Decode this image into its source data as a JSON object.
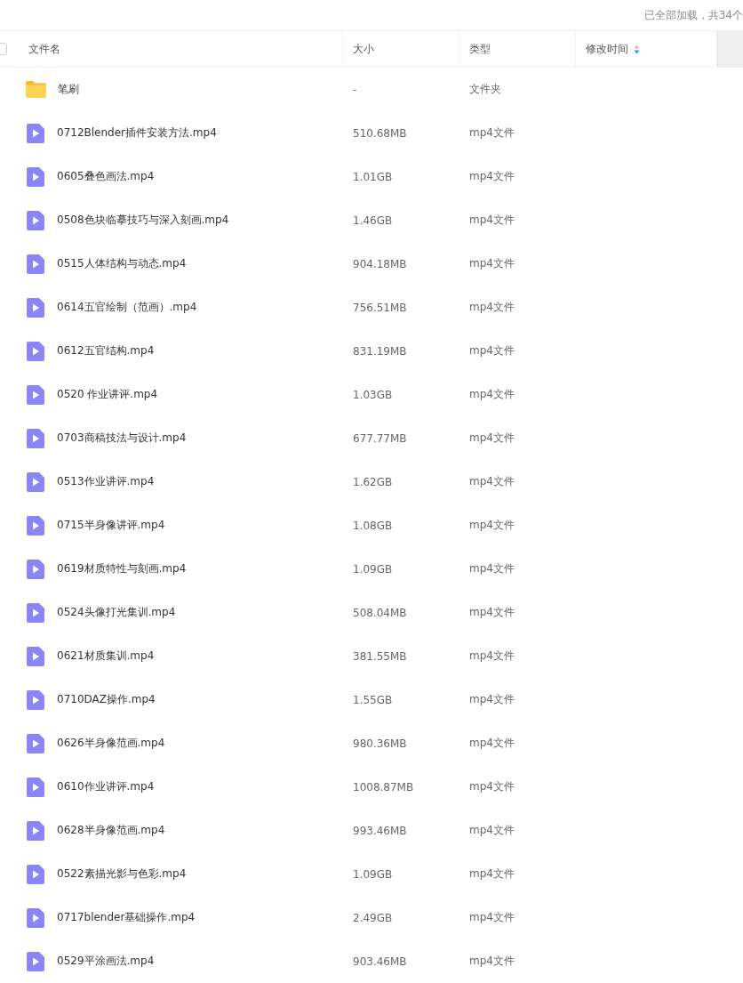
{
  "status_text": "已全部加载，共34个",
  "select_all": {
    "checked": false
  },
  "columns": [
    {
      "label": "文件名"
    },
    {
      "label": "大小"
    },
    {
      "label": "类型"
    },
    {
      "label": "修改时间",
      "sorted": true
    }
  ],
  "rows": [
    {
      "kind": "folder",
      "name": "笔刷",
      "size": "-",
      "type": "文件夹"
    },
    {
      "kind": "video",
      "name": "0712Blender插件安装方法.mp4",
      "size": "510.68MB",
      "type": "mp4文件"
    },
    {
      "kind": "video",
      "name": "0605叠色画法.mp4",
      "size": "1.01GB",
      "type": "mp4文件"
    },
    {
      "kind": "video",
      "name": "0508色块临摹技巧与深入刻画.mp4",
      "size": "1.46GB",
      "type": "mp4文件"
    },
    {
      "kind": "video",
      "name": "0515人体结构与动态.mp4",
      "size": "904.18MB",
      "type": "mp4文件"
    },
    {
      "kind": "video",
      "name": "0614五官绘制（范画）.mp4",
      "size": "756.51MB",
      "type": "mp4文件"
    },
    {
      "kind": "video",
      "name": "0612五官结构.mp4",
      "size": "831.19MB",
      "type": "mp4文件"
    },
    {
      "kind": "video",
      "name": "0520 作业讲评.mp4",
      "size": "1.03GB",
      "type": "mp4文件"
    },
    {
      "kind": "video",
      "name": "0703商稿技法与设计.mp4",
      "size": "677.77MB",
      "type": "mp4文件"
    },
    {
      "kind": "video",
      "name": "0513作业讲评.mp4",
      "size": "1.62GB",
      "type": "mp4文件"
    },
    {
      "kind": "video",
      "name": "0715半身像讲评.mp4",
      "size": "1.08GB",
      "type": "mp4文件"
    },
    {
      "kind": "video",
      "name": "0619材质特性与刻画.mp4",
      "size": "1.09GB",
      "type": "mp4文件"
    },
    {
      "kind": "video",
      "name": "0524头像打光集训.mp4",
      "size": "508.04MB",
      "type": "mp4文件"
    },
    {
      "kind": "video",
      "name": "0621材质集训.mp4",
      "size": "381.55MB",
      "type": "mp4文件"
    },
    {
      "kind": "video",
      "name": "0710DAZ操作.mp4",
      "size": "1.55GB",
      "type": "mp4文件"
    },
    {
      "kind": "video",
      "name": "0626半身像范画.mp4",
      "size": "980.36MB",
      "type": "mp4文件"
    },
    {
      "kind": "video",
      "name": "0610作业讲评.mp4",
      "size": "1008.87MB",
      "type": "mp4文件"
    },
    {
      "kind": "video",
      "name": "0628半身像范画.mp4",
      "size": "993.46MB",
      "type": "mp4文件"
    },
    {
      "kind": "video",
      "name": "0522素描光影与色彩.mp4",
      "size": "1.09GB",
      "type": "mp4文件"
    },
    {
      "kind": "video",
      "name": "0717blender基础操作.mp4",
      "size": "2.49GB",
      "type": "mp4文件"
    },
    {
      "kind": "video",
      "name": "0529平涂画法.mp4",
      "size": "903.46MB",
      "type": "mp4文件"
    }
  ]
}
